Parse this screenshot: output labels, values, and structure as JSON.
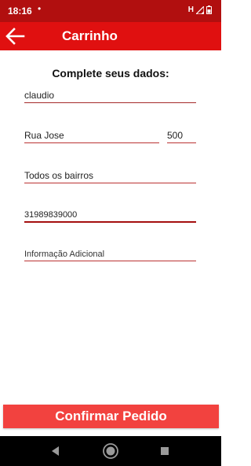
{
  "status_bar": {
    "time": "18:16",
    "dot": "•",
    "network": "H"
  },
  "app_bar": {
    "title": "Carrinho",
    "back_icon": "arrow-left-icon"
  },
  "form": {
    "title": "Complete seus dados:",
    "name_value": "claudio",
    "street_value": "Rua Jose",
    "number_value": "500",
    "district_value": "Todos os bairros",
    "phone_value": "31989839000",
    "info_placeholder": "Informação Adicional"
  },
  "actions": {
    "confirm_label": "Confirmar Pedido"
  },
  "colors": {
    "status_bar": "#b10f0f",
    "app_bar": "#e01010",
    "confirm_button": "#f2423f",
    "field_underline": "#a52a2a"
  },
  "nav": {
    "back_icon": "triangle-back-icon",
    "home_icon": "circle-home-icon",
    "recent_icon": "square-recent-icon"
  }
}
